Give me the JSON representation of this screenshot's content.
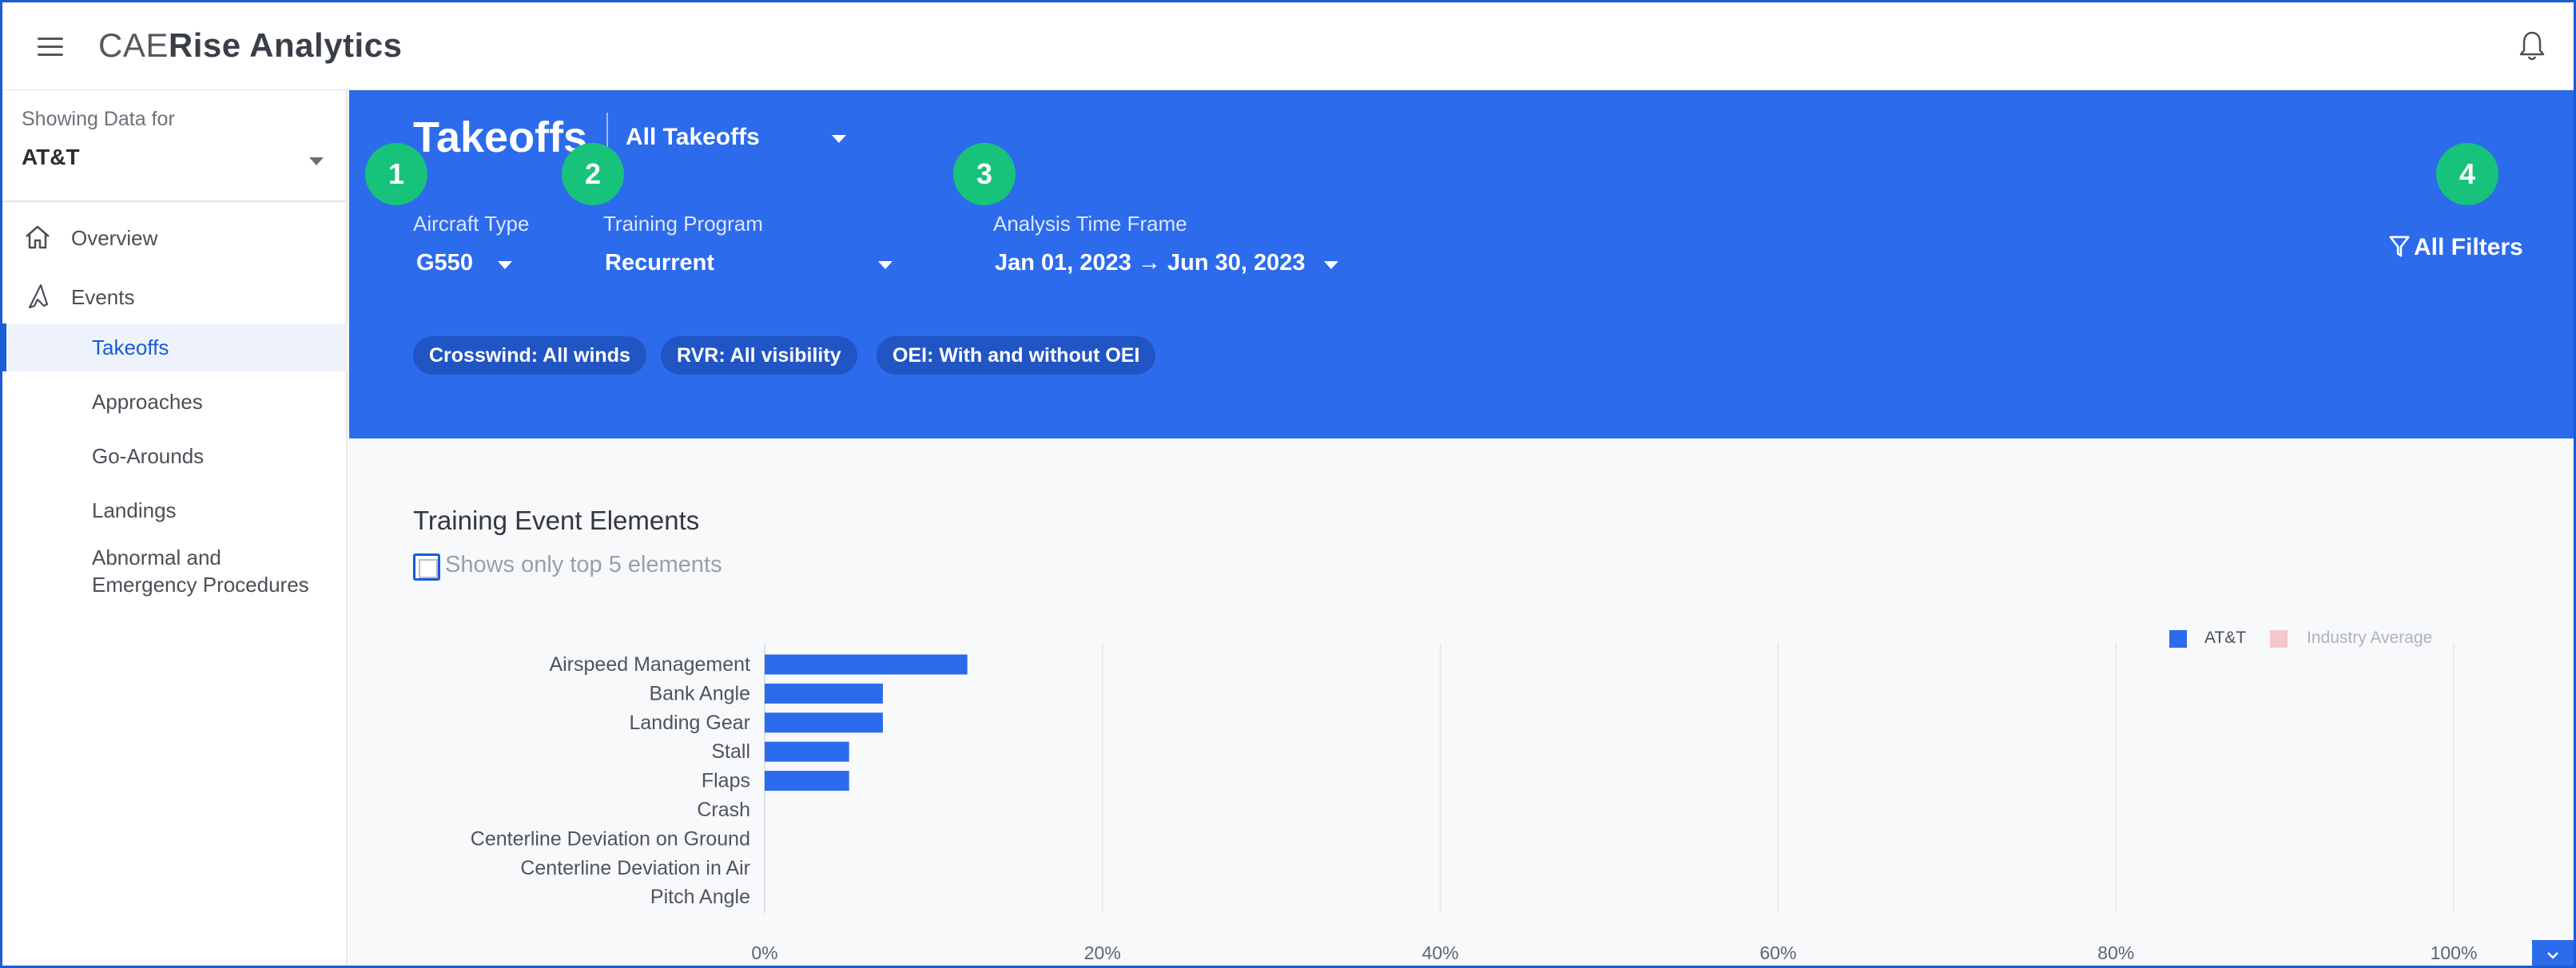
{
  "app": {
    "brand_prefix": "CAE",
    "brand_name": "Rise Analytics"
  },
  "sidebar": {
    "showing_label": "Showing Data for",
    "org": "AT&T",
    "items": [
      {
        "label": "Overview",
        "icon": "home-icon"
      },
      {
        "label": "Events",
        "icon": "aircraft-icon"
      }
    ],
    "sub_items": [
      {
        "label": "Takeoffs",
        "active": true
      },
      {
        "label": "Approaches"
      },
      {
        "label": "Go-Arounds"
      },
      {
        "label": "Landings"
      },
      {
        "label": "Abnormal and\nEmergency Procedures"
      }
    ]
  },
  "header": {
    "title": "Takeoffs",
    "event_select": "All Takeoffs",
    "filters": [
      {
        "badge": "1",
        "label": "Aircraft Type",
        "value": "G550"
      },
      {
        "badge": "2",
        "label": "Training Program",
        "value": "Recurrent"
      },
      {
        "badge": "3",
        "label": "Analysis Time Frame",
        "value": "Jan 01, 2023 → Jun 30, 2023"
      }
    ],
    "all_filters": {
      "badge": "4",
      "label": "All Filters"
    },
    "chips": [
      "Crosswind: All winds",
      "RVR: All visibility",
      "OEI: With and without OEI"
    ]
  },
  "main": {
    "section_title": "Training Event Elements",
    "top5_label": "Shows only top 5 elements",
    "top5_checked": false
  },
  "colors": {
    "accent": "#2c6bec",
    "badge": "#17c27a",
    "industry": "#f5c6cd"
  },
  "chart_data": {
    "type": "bar",
    "orientation": "horizontal",
    "categories": [
      "Airspeed Management",
      "Bank Angle",
      "Landing Gear",
      "Stall",
      "Flaps",
      "Crash",
      "Centerline Deviation on Ground",
      "Centerline Deviation in Air",
      "Pitch Angle"
    ],
    "series": [
      {
        "name": "AT&T",
        "color": "#2c6bec",
        "values": [
          12,
          7,
          7,
          5,
          5,
          0,
          0,
          0,
          0
        ]
      },
      {
        "name": "Industry Average",
        "color": "#f5c6cd",
        "values": [
          0,
          0,
          0,
          0,
          0,
          0,
          0,
          0,
          0
        ]
      }
    ],
    "xlim": [
      0,
      100
    ],
    "x_ticks": [
      "0%",
      "20%",
      "40%",
      "60%",
      "80%",
      "100%"
    ],
    "grid": true,
    "legend": "top-right"
  }
}
